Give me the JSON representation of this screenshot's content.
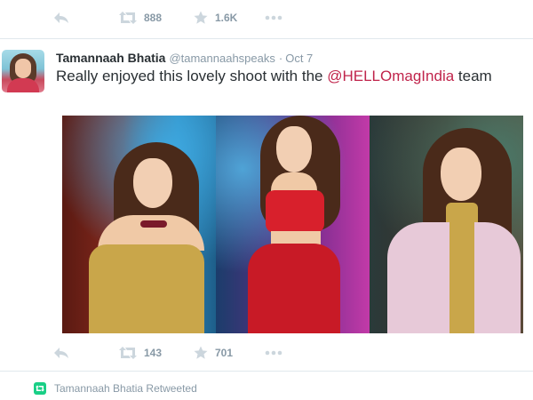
{
  "top_actions": {
    "retweet_count": "888",
    "favorite_count": "1.6K"
  },
  "tweet": {
    "fullname": "Tamannaah Bhatia",
    "username": "@tamannaahspeaks",
    "separator": "·",
    "time": "Oct 7",
    "text_before": "Really enjoyed this lovely shoot with the ",
    "mention": "@HELLOmagIndia",
    "text_after": " team",
    "actions": {
      "retweet_count": "143",
      "favorite_count": "701"
    }
  },
  "retweet_context": {
    "label": "Tamannaah Bhatia Retweeted"
  },
  "icons": {
    "reply": "reply-icon",
    "retweet": "retweet-icon",
    "favorite": "star-icon",
    "more": "more-dots-icon"
  },
  "colors": {
    "action_gray": "#8899a6",
    "mention": "#c0244b",
    "retweet_green": "#19cf86",
    "divider": "#e1e8ed"
  }
}
